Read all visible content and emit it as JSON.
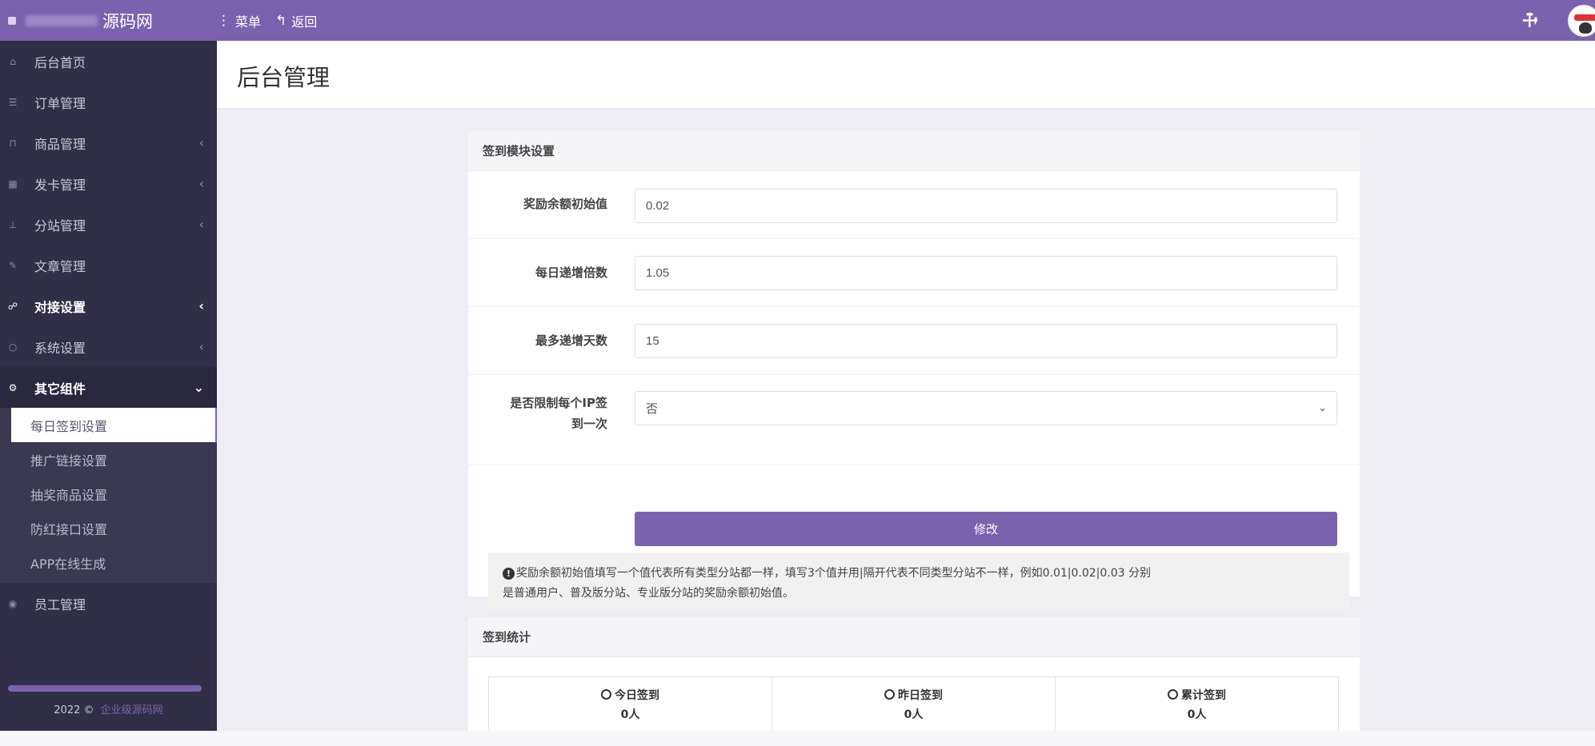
{
  "topbar": {
    "brand": "源码网",
    "menu_label": "菜单",
    "back_label": "返回"
  },
  "sidebar": {
    "items": [
      {
        "label": "后台首页",
        "icon": "home-icon"
      },
      {
        "label": "订单管理",
        "icon": "list-icon"
      },
      {
        "label": "商品管理",
        "icon": "cart-icon"
      },
      {
        "label": "发卡管理",
        "icon": "grid-icon"
      },
      {
        "label": "分站管理",
        "icon": "sitemap-icon"
      },
      {
        "label": "文章管理",
        "icon": "article-icon"
      },
      {
        "label": "对接设置",
        "icon": "link-icon"
      },
      {
        "label": "系统设置",
        "icon": "gear-icon"
      },
      {
        "label": "其它组件",
        "icon": "cogs-icon"
      }
    ],
    "subitems": [
      "每日签到设置",
      "推广链接设置",
      "抽奖商品设置",
      "防红接口设置",
      "APP在线生成"
    ],
    "staff_label": "员工管理",
    "copyright_year": "2022 ©",
    "copyright_link": "企业级源码网"
  },
  "page": {
    "title": "后台管理"
  },
  "signin_card": {
    "title": "签到模块设置",
    "fields": [
      {
        "label": "奖励余额初始值",
        "value": "0.02"
      },
      {
        "label": "每日递增倍数",
        "value": "1.05"
      },
      {
        "label": "最多递增天数",
        "value": "15"
      }
    ],
    "ip_limit_label_line1": "是否限制每个IP签",
    "ip_limit_label_line2": "到一次",
    "ip_limit_value": "否",
    "submit_label": "修改",
    "tip_line1": "奖励余额初始值填写一个值代表所有类型分站都一样，填写3个值并用|隔开代表不同类型分站不一样，例如0.01|0.02|0.03 分别",
    "tip_line2": "是普通用户、普及版分站、专业版分站的奖励余额初始值。"
  },
  "stats_card": {
    "title": "签到统计",
    "stats": [
      {
        "label": "今日签到",
        "value": "0人",
        "icon": "user-circle-icon"
      },
      {
        "label": "昨日签到",
        "value": "0人",
        "icon": "clock-icon"
      },
      {
        "label": "累计签到",
        "value": "0人",
        "icon": "pie-chart-icon"
      }
    ]
  },
  "colors": {
    "accent": "#7b62ae",
    "sidebar_bg": "#312f45"
  }
}
